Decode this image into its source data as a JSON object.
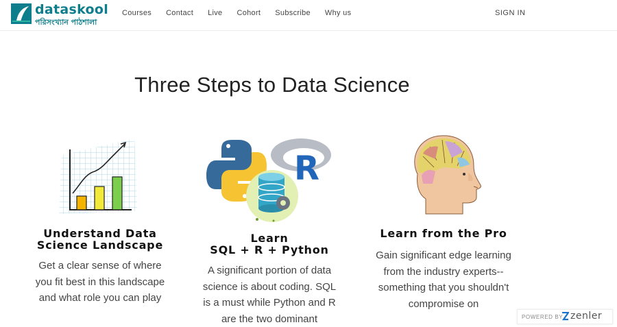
{
  "brand": {
    "name": "dataskool",
    "tagline": "পরিসংখ্যান পাঠশালা",
    "colors": {
      "primary": "#0f7e8c",
      "accent": "#2bb5a0"
    }
  },
  "nav": {
    "items": [
      {
        "label": "Courses"
      },
      {
        "label": "Contact"
      },
      {
        "label": "Live"
      },
      {
        "label": "Cohort"
      },
      {
        "label": "Subscribe"
      },
      {
        "label": "Why us"
      }
    ],
    "signin_label": "SIGN IN"
  },
  "hero": {
    "title": "Three Steps to Data Science"
  },
  "steps": [
    {
      "icon": "bar-chart-sketch-icon",
      "title_lines": [
        "Understand Data",
        "Science Landscape"
      ],
      "body_lines": [
        "Get a clear sense of where",
        "you fit best in this landscape",
        "and what role you can play"
      ]
    },
    {
      "icon": "python-r-sql-logos-icon",
      "title_lines": [
        "Learn",
        "SQL + R + Python"
      ],
      "body_lines": [
        "A significant portion of data",
        "science is about coding. SQL",
        "is a must while Python and R",
        "are the two dominant"
      ]
    },
    {
      "icon": "phrenology-head-icon",
      "title_lines": [
        "Learn from the Pro"
      ],
      "body_lines": [
        "Gain significant edge learning",
        "from the industry experts--",
        "something that you shouldn't",
        "compromise on"
      ]
    }
  ],
  "footer_badge": {
    "label": "POWERED BY",
    "brand": "zenler"
  }
}
